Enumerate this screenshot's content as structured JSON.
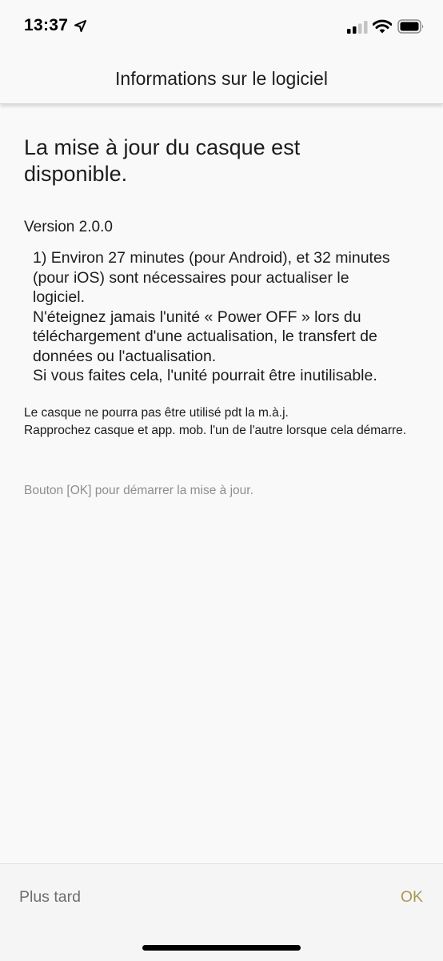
{
  "status_bar": {
    "time": "13:37",
    "icons": [
      "location-arrow-icon",
      "signal-icon",
      "wifi-icon",
      "battery-icon"
    ]
  },
  "nav": {
    "title": "Informations sur le logiciel"
  },
  "content": {
    "headline": "La mise à jour du casque est disponible.",
    "version": "Version 2.0.0",
    "release_notes": "1) Environ 27 minutes (pour Android), et 32 minutes (pour iOS) sont nécessaires pour actualiser le logiciel.\nN'éteignez jamais l'unité « Power OFF » lors du téléchargement d'une actualisation, le transfert de données ou l'actualisation.\nSi vous faites cela, l'unité pourrait être inutilisable.",
    "info": "Le casque ne pourra pas être utilisé pdt la m.à.j.\nRapprochez casque et app. mob. l'un de l'autre lorsque cela démarre.",
    "hint": "Bouton [OK] pour démarrer la mise à jour."
  },
  "actions": {
    "later_label": "Plus tard",
    "ok_label": "OK"
  },
  "colors": {
    "accent_ok": "#a79a55",
    "secondary_text": "#8e8e8e",
    "background": "#f9f9f9"
  }
}
